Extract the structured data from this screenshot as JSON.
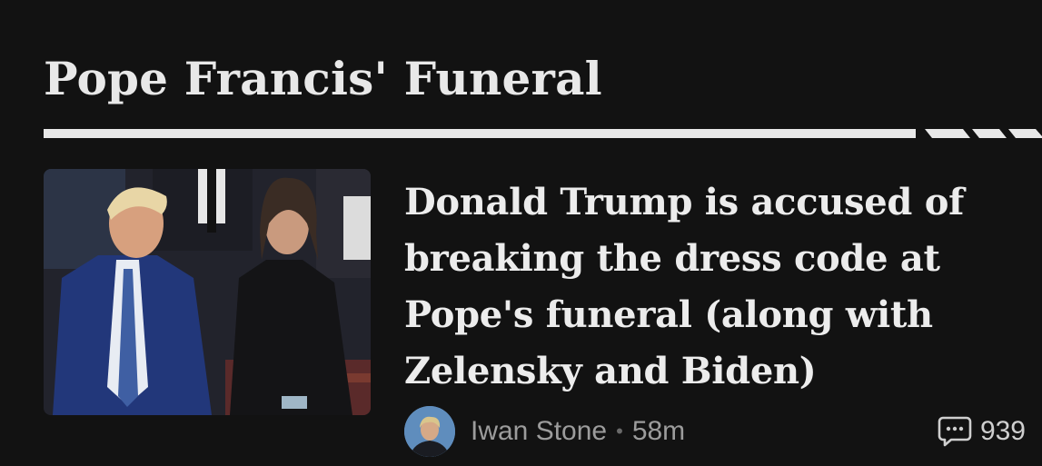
{
  "section": {
    "title": "Pope Francis' Funeral"
  },
  "article": {
    "headline": "Donald Trump is accused of breaking the dress code at Pope's funeral (along with Zelensky and Biden)",
    "thumbnail_icon": "news-photo",
    "author": "Iwan Stone",
    "separator": "•",
    "time_ago": "58m",
    "comment_icon": "comment-bubble-icon",
    "comment_count": "939"
  }
}
